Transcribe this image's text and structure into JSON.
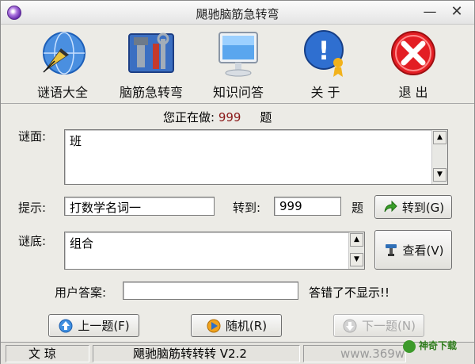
{
  "window": {
    "title": "飓驰脑筋急转弯",
    "minimize_label": "—",
    "close_label": "✕"
  },
  "toolbar": [
    {
      "label": "谜语大全",
      "icon": "fountain-pen-globe-icon"
    },
    {
      "label": "脑筋急转弯",
      "icon": "toolbox-icon"
    },
    {
      "label": "知识问答",
      "icon": "monitor-icon"
    },
    {
      "label": "关 于",
      "icon": "help-person-icon"
    },
    {
      "label": "退 出",
      "icon": "exit-x-icon"
    }
  ],
  "status": {
    "prefix": "您正在做:",
    "number": "999",
    "suffix": "题"
  },
  "riddle": {
    "label": "谜面:",
    "text": "班"
  },
  "hint": {
    "label": "提示:",
    "value": "打数学名词一"
  },
  "goto": {
    "label": "转到:",
    "value": "999",
    "suffix": "题",
    "button": "转到(G)"
  },
  "answer": {
    "label": "谜底:",
    "text": "组合",
    "button": "查看(V)"
  },
  "user_answer": {
    "label": "用户答案:",
    "value": "",
    "note": "答错了不显示!!"
  },
  "nav": {
    "prev": "上一题(F)",
    "random": "随机(R)",
    "next": "下一题(N)"
  },
  "statusbar": {
    "author": "文 琼",
    "product": "飓驰脑筋转转转 V2.2",
    "website": "www.369w",
    "watermark": "神奇下载"
  },
  "colors": {
    "status_number": "#8b1a1a",
    "window_bg": "#ecebe6"
  }
}
